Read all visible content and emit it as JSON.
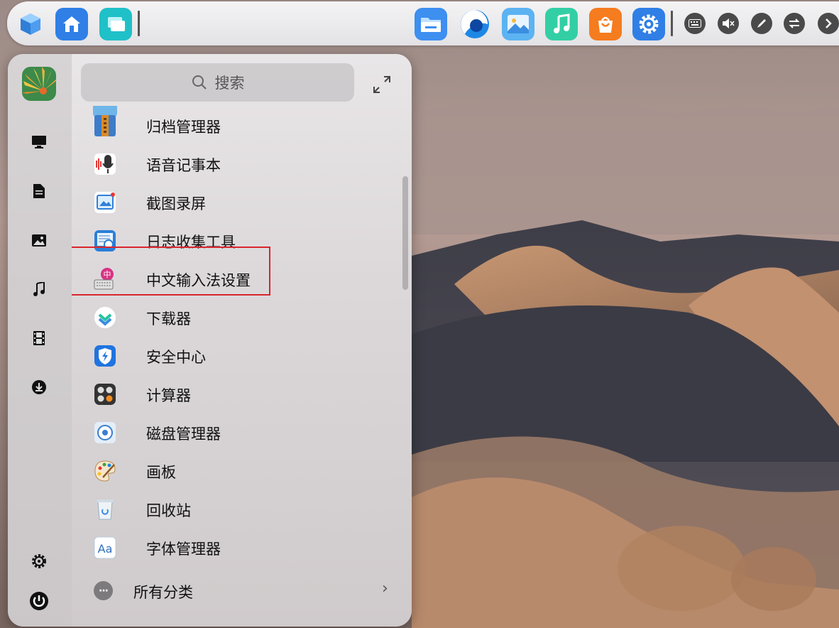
{
  "taskbar": {
    "apps": [
      {
        "icon": "cube-launcher-icon",
        "color": "#5aa8f0"
      },
      {
        "icon": "home-icon",
        "color": "#2f7fe6"
      },
      {
        "icon": "multitask-view-icon",
        "color": "#22c1c9"
      }
    ],
    "pinned": [
      {
        "icon": "file-manager-icon",
        "color": "#3d8ff0"
      },
      {
        "icon": "browser-icon",
        "color": "#1e88e5"
      },
      {
        "icon": "photos-icon",
        "color": "#5cb3f2"
      },
      {
        "icon": "music-icon",
        "color": "#3ad0a8"
      },
      {
        "icon": "app-store-icon",
        "color": "#f57c1f"
      },
      {
        "icon": "settings-icon",
        "color": "#2f7fe6"
      }
    ],
    "tray": [
      "keyboard-icon",
      "mute-icon",
      "pen-icon",
      "swap-icon",
      "chevron-right-icon"
    ]
  },
  "sidebar": {
    "items": [
      "monitor-icon",
      "document-icon",
      "image-icon",
      "music-note-icon",
      "film-icon",
      "download-icon"
    ],
    "bottom": [
      "settings-gear-icon",
      "power-icon"
    ]
  },
  "search": {
    "placeholder": "搜索"
  },
  "apps": [
    {
      "label": "归档管理器",
      "icon": "archive-manager-icon"
    },
    {
      "label": "语音记事本",
      "icon": "voice-notes-icon"
    },
    {
      "label": "截图录屏",
      "icon": "screenshot-recorder-icon",
      "highlighted": true
    },
    {
      "label": "日志收集工具",
      "icon": "log-collector-icon"
    },
    {
      "label": "中文输入法设置",
      "icon": "input-method-icon"
    },
    {
      "label": "下载器",
      "icon": "downloader-icon"
    },
    {
      "label": "安全中心",
      "icon": "security-center-icon"
    },
    {
      "label": "计算器",
      "icon": "calculator-icon"
    },
    {
      "label": "磁盘管理器",
      "icon": "disk-manager-icon"
    },
    {
      "label": "画板",
      "icon": "draw-board-icon"
    },
    {
      "label": "回收站",
      "icon": "trash-icon"
    },
    {
      "label": "字体管理器",
      "icon": "font-manager-icon"
    }
  ],
  "all_categories": {
    "label": "所有分类"
  }
}
